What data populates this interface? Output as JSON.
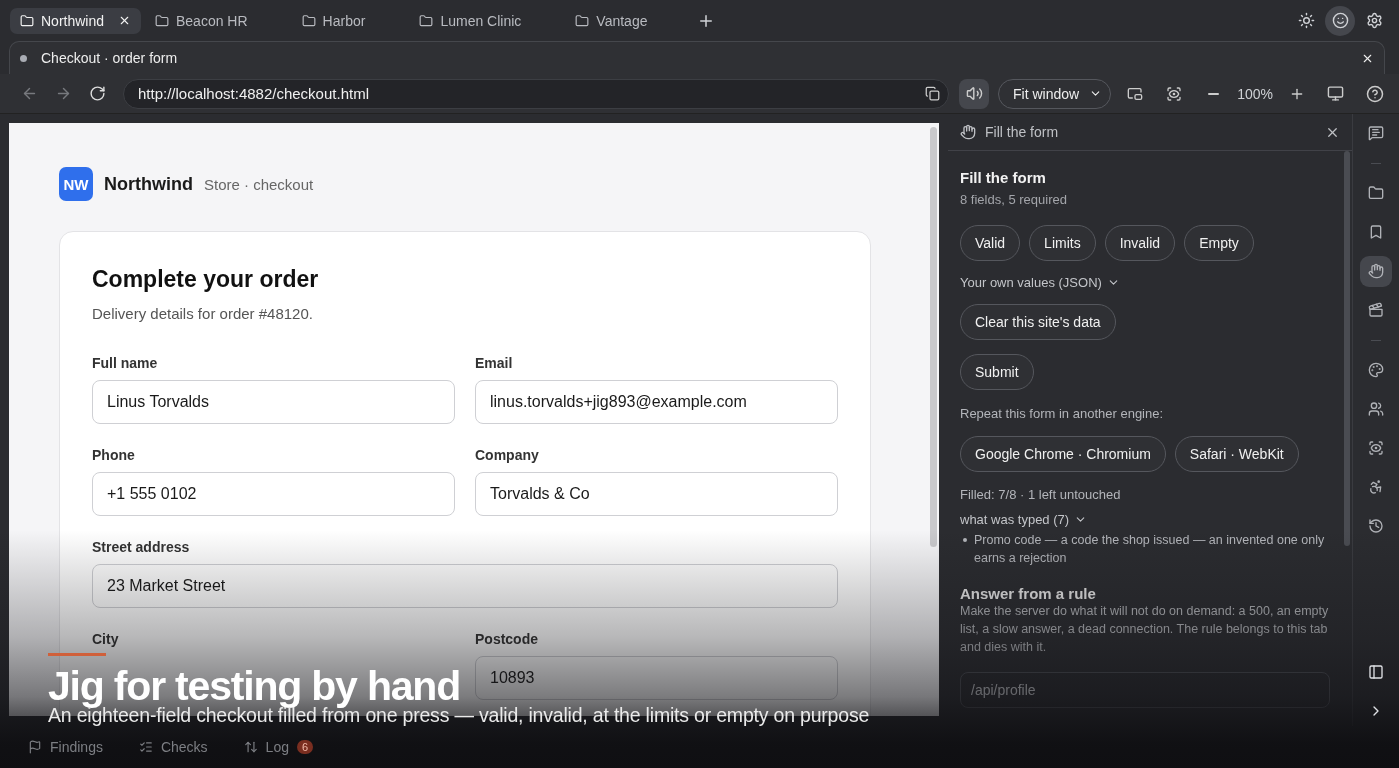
{
  "tabs": [
    {
      "label": "Northwind",
      "selected": true
    },
    {
      "label": "Beacon HR",
      "selected": false
    },
    {
      "label": "Harbor",
      "selected": false
    },
    {
      "label": "Lumen Clinic",
      "selected": false
    },
    {
      "label": "Vantage",
      "selected": false
    }
  ],
  "top_actions": [
    {
      "selected": false
    },
    {
      "selected": true
    },
    {
      "selected": false
    }
  ],
  "document_tab": {
    "title": "Checkout · order form"
  },
  "toolbar": {
    "url": "http://localhost:4882/checkout.html",
    "audio_selected": true,
    "fit": "Fit window",
    "zoom": "100%"
  },
  "page": {
    "logo": "NW",
    "brand": "Northwind",
    "subtitle": "Store · checkout",
    "heading": "Complete your order",
    "intro": "Delivery details for order #48120.",
    "fields": [
      {
        "label": "Full name",
        "value": "Linus Torvalds",
        "wide": false
      },
      {
        "label": "Email",
        "value": "linus.torvalds+jig893@example.com",
        "wide": false
      },
      {
        "label": "Phone",
        "value": "+1 555 0102",
        "wide": false
      },
      {
        "label": "Company",
        "value": "Torvalds & Co",
        "wide": false
      },
      {
        "label": "Street address",
        "value": "23 Market Street",
        "wide": true
      },
      {
        "label": "City",
        "wide": false
      },
      {
        "label": "Postcode",
        "value": "10893",
        "wide": false
      }
    ]
  },
  "panel": {
    "header": "Fill the form",
    "title": "Fill the form",
    "summary": "8 fields, 5 required",
    "presets": [
      "Valid",
      "Limits",
      "Invalid",
      "Empty"
    ],
    "own_values": "Your own values (JSON)",
    "actions": [
      "Clear this site's data",
      "Submit"
    ],
    "engines_label": "Repeat this form in another engine:",
    "engines": [
      "Google Chrome · Chromium",
      "Safari · WebKit"
    ],
    "filled": "Filled: 7/8 · 1 left untouched",
    "typed": "what was typed (7)",
    "notes": [
      "Promo code — a code the shop issued — an invented one only earns a rejection"
    ],
    "rule_title": "Answer from a rule",
    "rule_text": "Make the server do what it will not do on demand: a 500, an empty list, a slow answer, a dead connection. The rule belongs to this tab and dies with it.",
    "rule_placeholder": "/api/profile"
  },
  "rail": [
    {
      "selected": false
    },
    {
      "selected": false
    },
    {
      "selected": false
    },
    {
      "selected": true
    },
    {
      "selected": false
    },
    {
      "selected": false
    },
    {
      "selected": false
    },
    {
      "selected": false
    },
    {
      "selected": false
    },
    {
      "selected": false
    }
  ],
  "bottom_tabs": [
    {
      "label": "Findings"
    },
    {
      "label": "Checks"
    },
    {
      "label": "Log",
      "badge": "6"
    }
  ],
  "caption": {
    "title": "Jig for testing by hand",
    "subtitle": "An eighteen-field checkout filled from one press — valid, invalid, at the limits or empty on purpose"
  }
}
